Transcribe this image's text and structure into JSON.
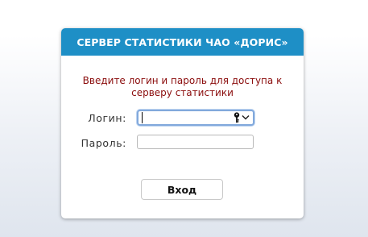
{
  "header": {
    "title": "СЕРВЕР СТАТИСТИКИ ЧАО «ДОРИС»"
  },
  "form": {
    "message_line1": "Введите логин и пароль для доступа к",
    "message_line2": "серверу статистики",
    "login_label": "Логин:",
    "login_value": "",
    "password_label": "Пароль:",
    "password_value": "",
    "submit_label": "Вход"
  },
  "icons": {
    "password_manager": "key-icon",
    "autofill_dropdown": "chevron-down-icon"
  },
  "colors": {
    "header_bg": "#1e8fc6",
    "message_text": "#8b0d0d",
    "focus_ring": "#82a9dc"
  }
}
